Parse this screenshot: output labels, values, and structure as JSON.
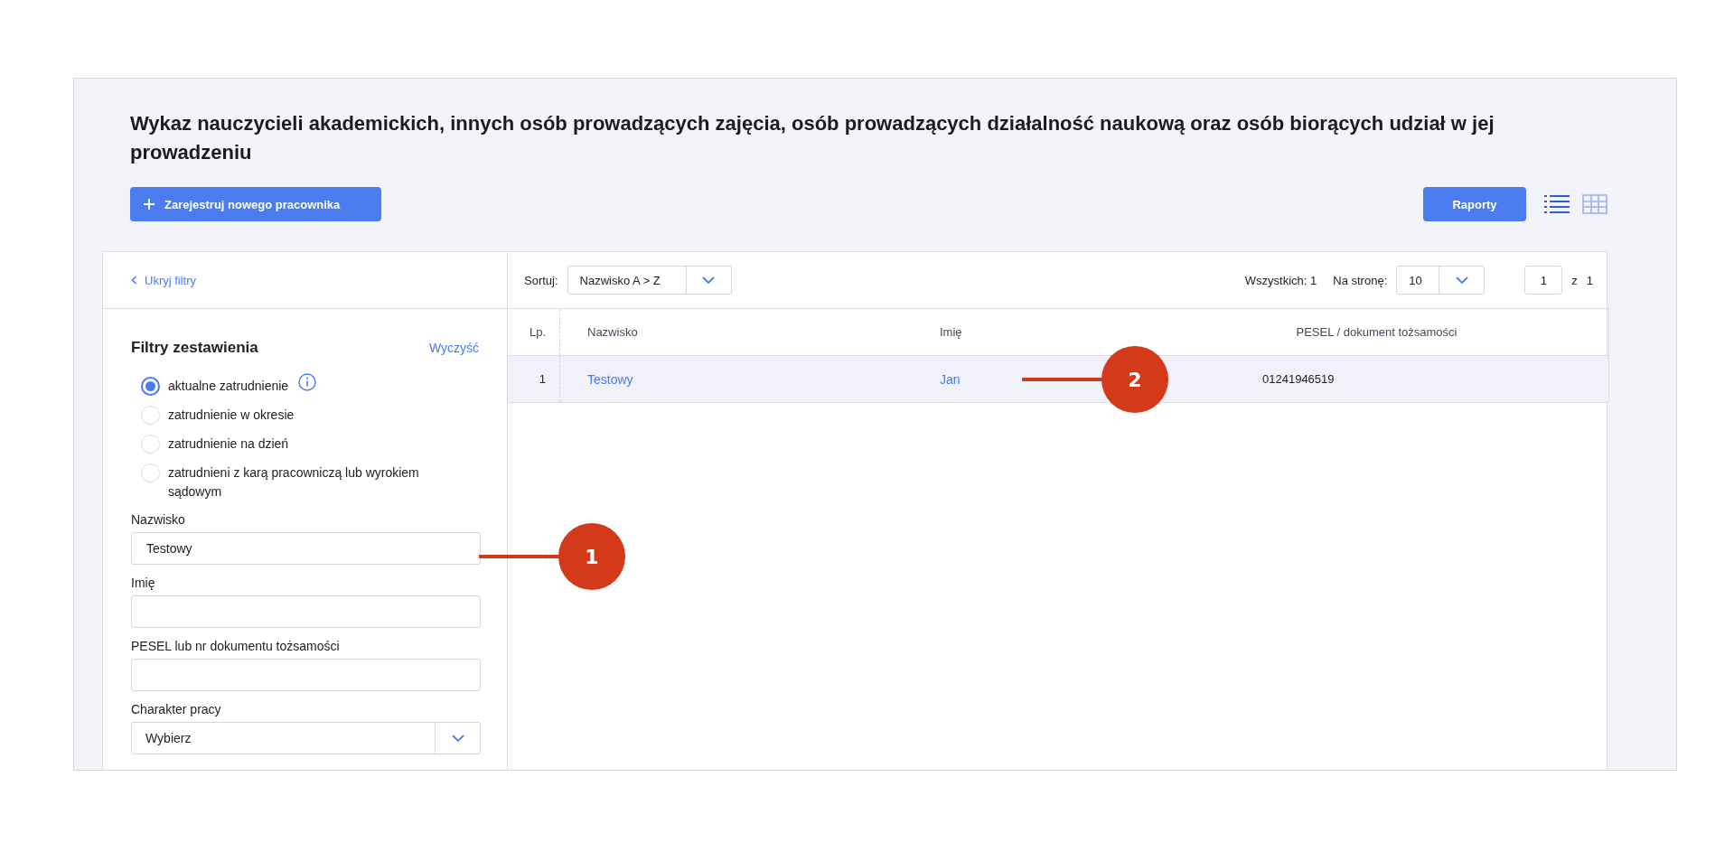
{
  "page": {
    "title": "Wykaz nauczycieli akademickich, innych osób prowadzących zajęcia, osób prowadzących działalność naukową oraz osób biorących udział w jej prowadzeniu"
  },
  "toolbar": {
    "add_button": "Zarejestruj nowego pracownika",
    "reports_button": "Raporty",
    "views": [
      {
        "kind": "list",
        "selected": true
      },
      {
        "kind": "grid",
        "selected": false
      }
    ]
  },
  "filters": {
    "hide_link": "Ukryj filtry",
    "title": "Filtry zestawienia",
    "clear_link": "Wyczyść",
    "options": [
      {
        "label": "aktualne zatrudnienie",
        "selected": true,
        "info": true
      },
      {
        "label": "zatrudnienie w okresie",
        "selected": false,
        "info": false
      },
      {
        "label": "zatrudnienie na dzień",
        "selected": false,
        "info": false
      },
      {
        "label": "zatrudnieni z karą pracowniczą lub wyrokiem sądowym",
        "selected": false,
        "info": false
      }
    ],
    "fields": [
      {
        "kind": "text",
        "label": "Nazwisko",
        "value": "Testowy"
      },
      {
        "kind": "text",
        "label": "Imię"
      },
      {
        "kind": "text",
        "label": "PESEL lub nr dokumentu tożsamości"
      },
      {
        "kind": "select",
        "label": "Charakter pracy",
        "value": "Wybierz"
      }
    ]
  },
  "list_bar": {
    "sort_label": "Sortuj:",
    "sort_value": "Nazwisko A > Z",
    "total": "Wszystkich: 1",
    "per_page_label": "Na stronę:",
    "per_page_value": "10",
    "page": "1",
    "page_of": "z",
    "page_count": "1"
  },
  "table": {
    "columns": [
      "Lp.",
      "Nazwisko",
      "Imię",
      "PESEL / dokument tożsamości"
    ],
    "rows": [
      {
        "lp": "1",
        "surname": "Testowy",
        "name": "Jan",
        "pesel": "01241946519",
        "selected": true
      }
    ]
  },
  "callouts": [
    {
      "number": "1"
    },
    {
      "number": "2"
    }
  ]
}
